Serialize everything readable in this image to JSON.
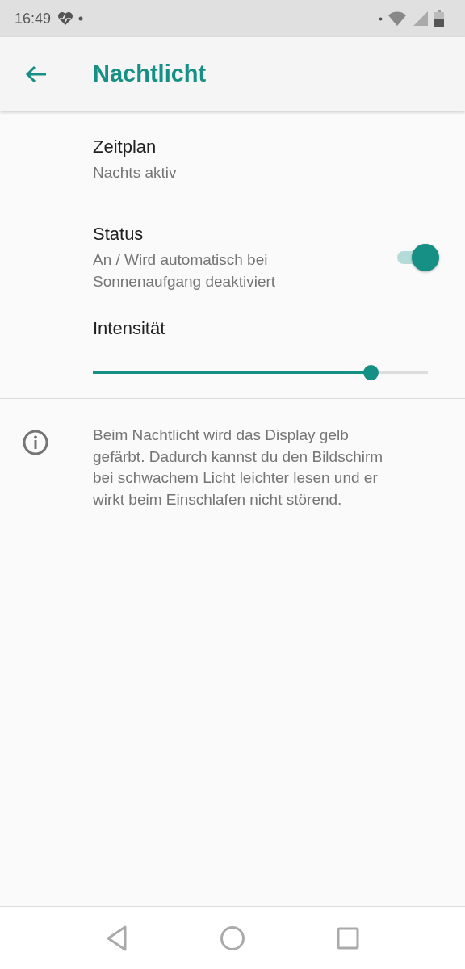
{
  "status_bar": {
    "time": "16:49"
  },
  "app_bar": {
    "title": "Nachtlicht"
  },
  "settings": [
    {
      "kind": "text",
      "title": "Zeitplan",
      "summary": "Nachts aktiv"
    },
    {
      "kind": "switch",
      "title": "Status",
      "summary": "An / Wird automatisch bei Sonnenaufgang deaktiviert",
      "on": true
    },
    {
      "kind": "slider",
      "title": "Intensität",
      "level": 0.83
    }
  ],
  "info": {
    "text": "Beim Nachtlicht wird das Display gelb gefärbt. Dadurch kannst du den Bildschirm bei schwachem Licht leichter lesen und er wirkt beim Einschlafen nicht störend."
  }
}
